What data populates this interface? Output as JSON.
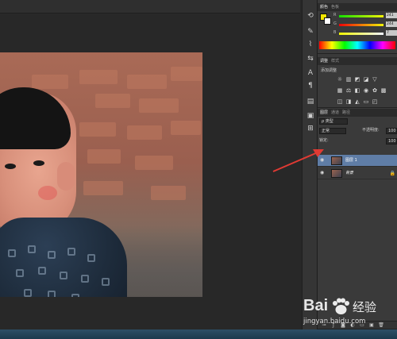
{
  "colors": {
    "foreground": "#f2e500",
    "background": "#ffffff",
    "selected_layer": "#5f7da6",
    "arrow": "#e03a33"
  },
  "color_panel": {
    "tabs": [
      "颜色",
      "色板"
    ],
    "sliders": [
      {
        "channel": "R",
        "value": "241"
      },
      {
        "channel": "G",
        "value": "244"
      },
      {
        "channel": "B",
        "value": "7"
      }
    ]
  },
  "adjustments_panel": {
    "tabs": [
      "调整",
      "样式"
    ],
    "title": "添加调整",
    "icons": [
      "brightness-icon",
      "levels-icon",
      "curves-icon",
      "exposure-icon",
      "vibrance-icon",
      "hue-icon",
      "color-balance-icon",
      "bw-icon",
      "photo-filter-icon",
      "channel-mixer-icon",
      "color-lookup-icon",
      "invert-icon",
      "posterize-icon",
      "threshold-icon",
      "gradient-map-icon",
      "selective-color-icon"
    ]
  },
  "layers_panel": {
    "tabs": [
      "图层",
      "通道",
      "路径"
    ],
    "filter_label": "ρ 类型",
    "blend_mode": "正常",
    "opacity_label": "不透明度:",
    "opacity_value": "100",
    "lock_label": "锁定:",
    "fill_value": "100",
    "layers": [
      {
        "name": "图层 1",
        "selected": true
      },
      {
        "name": "背景",
        "selected": false
      }
    ]
  },
  "watermark": {
    "bai": "Bai",
    "cn": "经验",
    "url": "jingyan.baidu.com"
  }
}
